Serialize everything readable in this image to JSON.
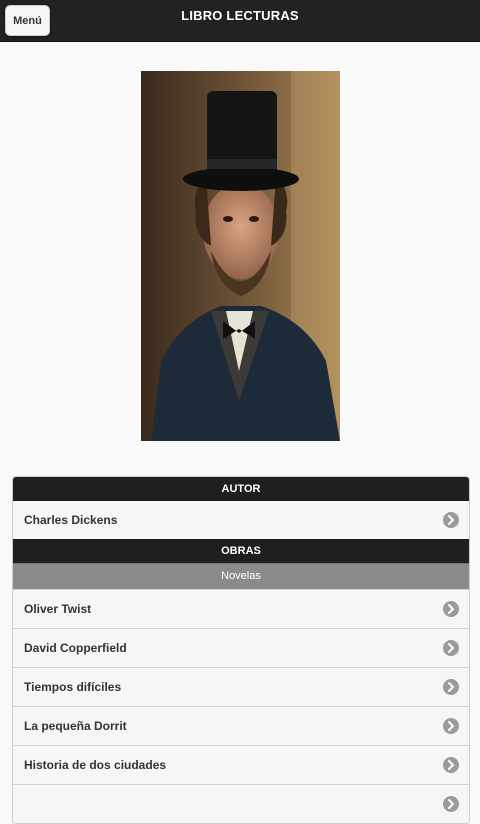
{
  "header": {
    "menu_label": "Menú",
    "title": "LIBRO LECTURAS"
  },
  "author_section": {
    "heading": "AUTOR",
    "name": "Charles Dickens"
  },
  "works_section": {
    "heading": "OBRAS",
    "subheading": "Novelas",
    "items": [
      {
        "label": "Oliver Twist"
      },
      {
        "label": "David Copperfield"
      },
      {
        "label": "Tiempos difíciles"
      },
      {
        "label": "La pequeña Dorrit"
      },
      {
        "label": "Historia de dos ciudades"
      },
      {
        "label": ""
      }
    ]
  },
  "colors": {
    "header_bg": "#222222",
    "divider_dark": "#1f1f1f",
    "divider_gray": "#8b8b8b",
    "arrow": "#9b9b9b"
  },
  "icons": {
    "list_arrow": "chevron-right-circle-icon"
  }
}
